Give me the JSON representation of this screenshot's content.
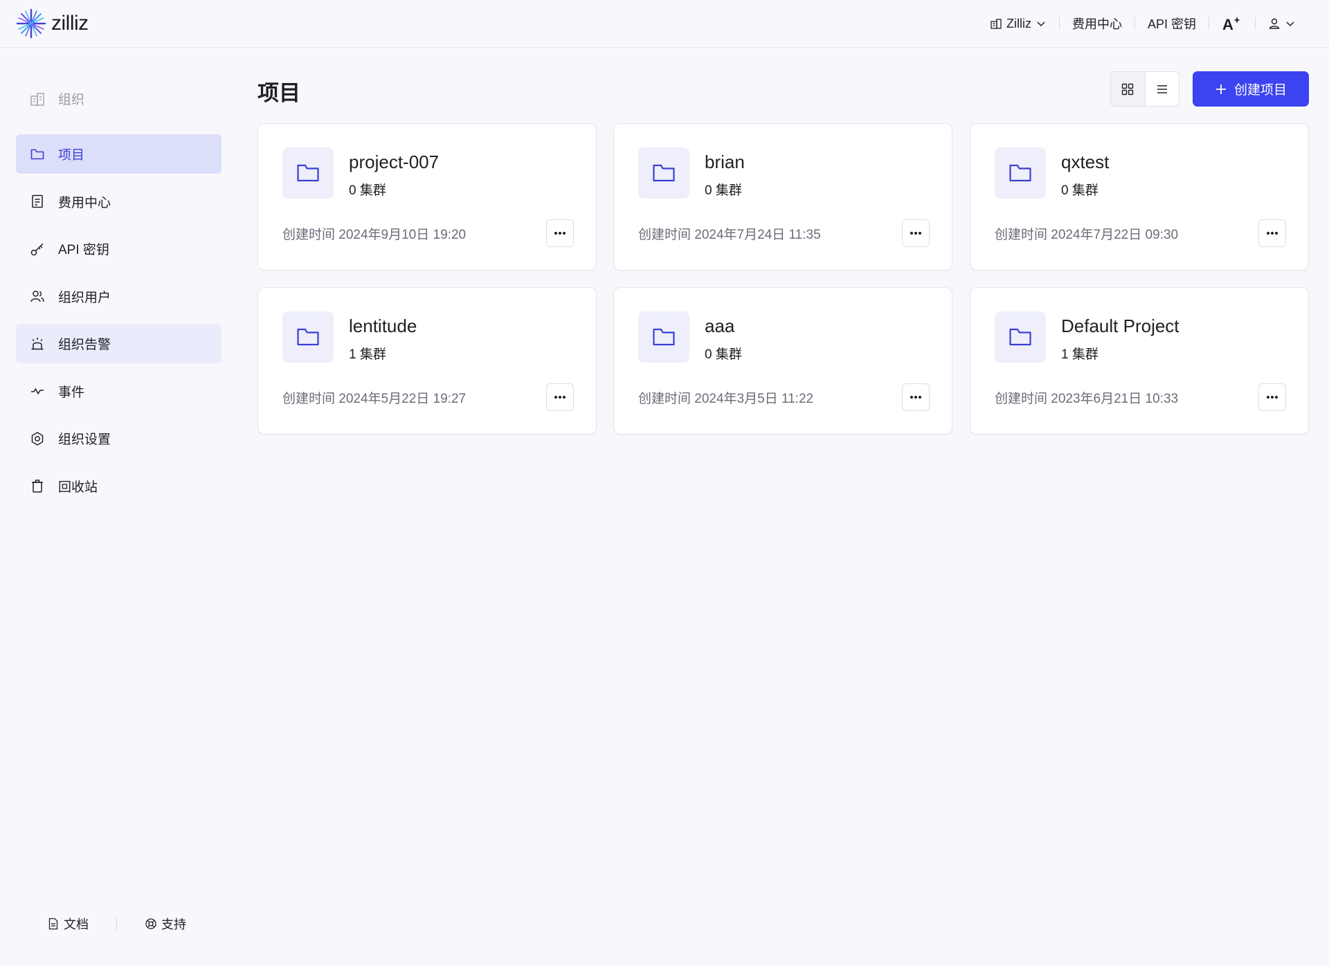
{
  "header": {
    "logo_text": "zilliz",
    "org_label": "Zilliz",
    "billing_label": "费用中心",
    "api_key_label": "API 密钥"
  },
  "sidebar": {
    "items": [
      {
        "label": "组织",
        "icon": "building-icon"
      },
      {
        "label": "项目",
        "icon": "folder-icon"
      },
      {
        "label": "费用中心",
        "icon": "receipt-icon"
      },
      {
        "label": "API 密钥",
        "icon": "key-icon"
      },
      {
        "label": "组织用户",
        "icon": "users-icon"
      },
      {
        "label": "组织告警",
        "icon": "alarm-icon"
      },
      {
        "label": "事件",
        "icon": "activity-icon"
      },
      {
        "label": "组织设置",
        "icon": "gear-icon"
      },
      {
        "label": "回收站",
        "icon": "trash-icon"
      }
    ],
    "active_item": "项目",
    "footer": {
      "docs_label": "文档",
      "support_label": "支持"
    }
  },
  "main": {
    "title": "项目",
    "create_button_label": "创建项目",
    "projects": [
      {
        "name": "project-007",
        "clusters": "0 集群",
        "created": "创建时间 2024年9月10日 19:20"
      },
      {
        "name": "brian",
        "clusters": "0 集群",
        "created": "创建时间 2024年7月24日 11:35"
      },
      {
        "name": "qxtest",
        "clusters": "0 集群",
        "created": "创建时间 2024年7月22日 09:30"
      },
      {
        "name": "lentitude",
        "clusters": "1 集群",
        "created": "创建时间 2024年5月22日 19:27"
      },
      {
        "name": "aaa",
        "clusters": "0 集群",
        "created": "创建时间 2024年3月5日 11:22"
      },
      {
        "name": "Default Project",
        "clusters": "1 集群",
        "created": "创建时间 2023年6月21日 10:33"
      }
    ]
  },
  "colors": {
    "accent": "#3b44f0",
    "active_nav_bg": "#dcdff9",
    "folder_icon": "#3b3fd3"
  }
}
